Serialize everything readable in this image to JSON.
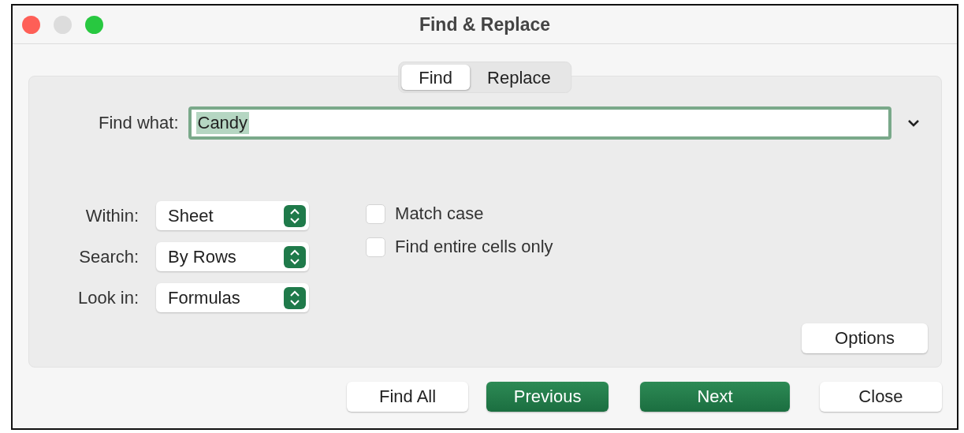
{
  "window": {
    "title": "Find & Replace"
  },
  "tabs": [
    {
      "label": "Find",
      "selected": true
    },
    {
      "label": "Replace",
      "selected": false
    }
  ],
  "find_what": {
    "label": "Find what:",
    "value": "Candy",
    "highlighted": true
  },
  "selects": [
    {
      "label": "Within:",
      "value": "Sheet"
    },
    {
      "label": "Search:",
      "value": "By Rows"
    },
    {
      "label": "Look in:",
      "value": "Formulas"
    }
  ],
  "checkboxes": [
    {
      "label": "Match case",
      "checked": false
    },
    {
      "label": "Find entire cells only",
      "checked": false
    }
  ],
  "options_button": "Options",
  "buttons": [
    {
      "label": "Find All",
      "kind": "default"
    },
    {
      "label": "Previous",
      "kind": "primary"
    },
    {
      "label": "Next",
      "kind": "primary"
    },
    {
      "label": "Close",
      "kind": "default"
    }
  ]
}
